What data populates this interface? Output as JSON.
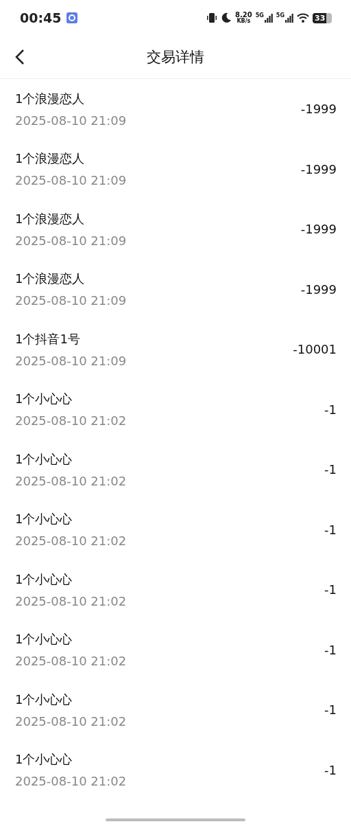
{
  "status_bar": {
    "time": "00:45",
    "speed_value": "8.20",
    "speed_unit": "KB/s",
    "sim1": "5G",
    "sim2": "5G",
    "battery": "33"
  },
  "header": {
    "title": "交易详情"
  },
  "transactions": [
    {
      "title": "1个浪漫恋人",
      "date": "2025-08-10 21:09",
      "amount": "-1999"
    },
    {
      "title": "1个浪漫恋人",
      "date": "2025-08-10 21:09",
      "amount": "-1999"
    },
    {
      "title": "1个浪漫恋人",
      "date": "2025-08-10 21:09",
      "amount": "-1999"
    },
    {
      "title": "1个浪漫恋人",
      "date": "2025-08-10 21:09",
      "amount": "-1999"
    },
    {
      "title": "1个抖音1号",
      "date": "2025-08-10 21:09",
      "amount": "-10001"
    },
    {
      "title": "1个小心心",
      "date": "2025-08-10 21:02",
      "amount": "-1"
    },
    {
      "title": "1个小心心",
      "date": "2025-08-10 21:02",
      "amount": "-1"
    },
    {
      "title": "1个小心心",
      "date": "2025-08-10 21:02",
      "amount": "-1"
    },
    {
      "title": "1个小心心",
      "date": "2025-08-10 21:02",
      "amount": "-1"
    },
    {
      "title": "1个小心心",
      "date": "2025-08-10 21:02",
      "amount": "-1"
    },
    {
      "title": "1个小心心",
      "date": "2025-08-10 21:02",
      "amount": "-1"
    },
    {
      "title": "1个小心心",
      "date": "2025-08-10 21:02",
      "amount": "-1"
    }
  ]
}
